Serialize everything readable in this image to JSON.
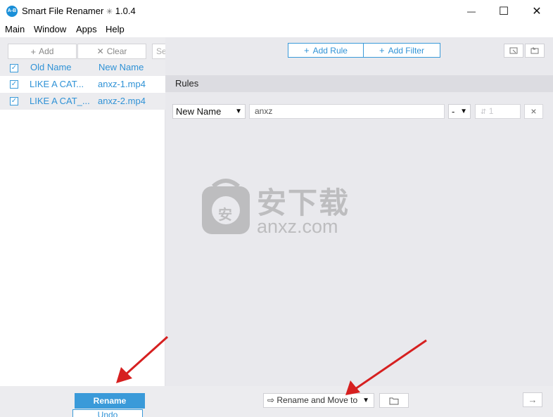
{
  "window": {
    "title": "Smart File Renamer",
    "version": "1.0.4",
    "separator": "✳",
    "icon_text": "A-B",
    "minimize_glyph": "—",
    "maximize_glyph": "☐",
    "close_glyph": "✕"
  },
  "menu": [
    "Main",
    "Window",
    "Apps",
    "Help"
  ],
  "left_toolbar": {
    "add_label": "Add",
    "clear_label": "Clear",
    "search_placeholder_fragment": "Se"
  },
  "file_list": {
    "headers": {
      "old": "Old Name",
      "new": "New Name"
    },
    "rows": [
      {
        "old": "LIKE A CAT...",
        "new": "anxz-1.mp4",
        "checked": true
      },
      {
        "old": "LIKE A CAT_...",
        "new": "anxz-2.mp4",
        "checked": true
      }
    ]
  },
  "rule_toolbar": {
    "add_rule_label": "Add Rule",
    "add_filter_label": "Add Filter"
  },
  "rules": {
    "title": "Rules",
    "rule_type": "New Name",
    "pattern_value": "anxz",
    "separator_value": "-",
    "start_placeholder": "1",
    "remove_glyph": "×"
  },
  "bottom": {
    "rename_label": "Rename",
    "undo_label": "Undo",
    "rename_move_label": "⇨ Rename and Move to",
    "folder_icon": "folder-icon",
    "go_icon": "arrow-right-icon"
  },
  "watermark": {
    "cn_text": "安下载",
    "url_text": "anxz.com",
    "badge_char": "安"
  },
  "colors": {
    "accent": "#3a9ad9",
    "annotation_arrow": "#d62020",
    "panel_bg": "#e9e9ed"
  }
}
